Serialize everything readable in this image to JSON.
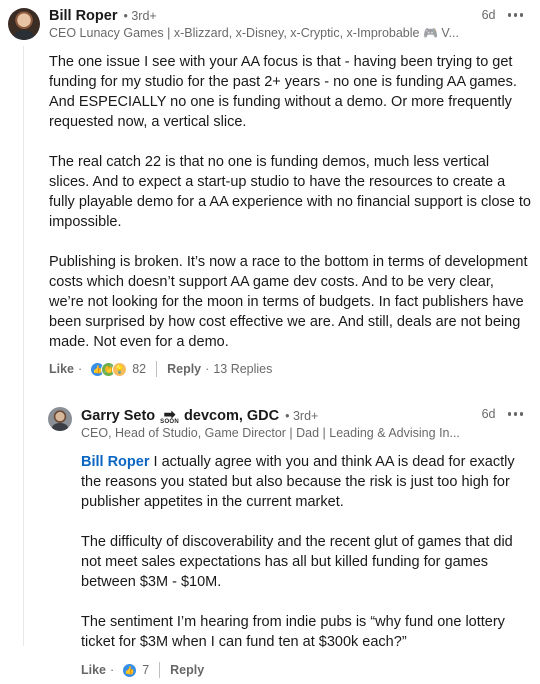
{
  "comment": {
    "author": "Bill Roper",
    "degree": "• 3rd+",
    "headline": "CEO Lunacy Games | x-Blizzard, x-Disney, x-Cryptic, x-Improbable",
    "headline_ellipsis": " V...",
    "time": "6d",
    "paragraphs": [
      "The one issue I see with your AA focus is that - having been trying to get funding for my studio for the past 2+ years - no one is funding AA games. And ESPECIALLY no one is funding without a demo. Or more frequently requested now, a vertical slice.",
      "The real catch 22 is that no one is funding demos, much less vertical slices. And to expect a start-up studio to have the resources to create a fully playable demo for a AA experience with no financial support is close to impossible.",
      "Publishing is broken. It’s now a race to the bottom in terms of development costs which doesn’t support AA game dev costs. And to be very clear, we’re not looking for the moon in terms of budgets. In fact publishers have been surprised by how cost effective we are. And still, deals are not being made. Not even for a demo."
    ],
    "actions": {
      "like": "Like",
      "reaction_count": "82",
      "reply": "Reply",
      "replies": "13 Replies"
    }
  },
  "reply": {
    "author_first": "Garry Seto",
    "soon_label": "SOON",
    "author_rest": "devcom, GDC",
    "degree": "• 3rd+",
    "headline": "CEO, Head of Studio, Game Director | Dad | Leading & Advising In...",
    "time": "6d",
    "mention": "Bill Roper",
    "first_paragraph_rest": " I actually agree with you and think AA is dead for exactly the reasons you stated but also because the risk is just too high for publisher appetites in the current market.",
    "paragraphs": [
      "The difficulty of discoverability and the recent glut of games that did not meet sales expectations has all but killed funding for games between $3M - $10M.",
      "The sentiment I’m hearing from indie pubs is “why fund one lottery ticket for $3M when I can fund ten at $300k each?”"
    ],
    "actions": {
      "like": "Like",
      "reaction_count": "7",
      "reply": "Reply"
    }
  },
  "colors": {
    "accent": "#0a66c2",
    "like_reaction": "#378fe9",
    "celebrate_reaction": "#6dae4f",
    "insightful_reaction": "#f5bb5c"
  }
}
